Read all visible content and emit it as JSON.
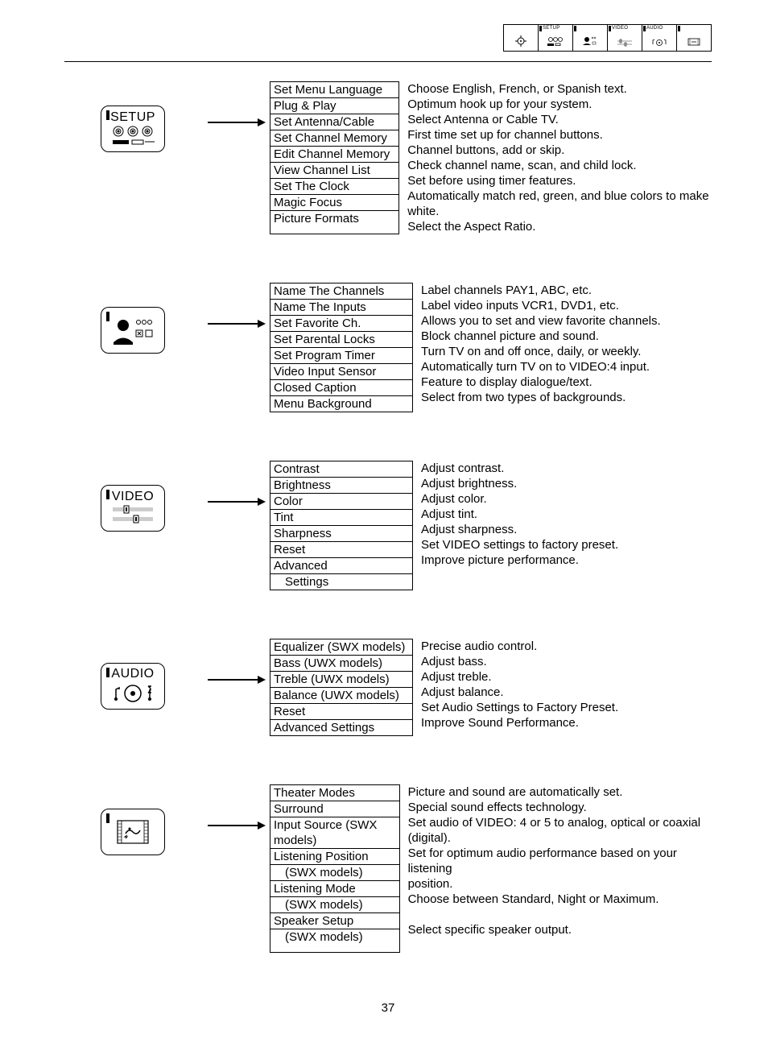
{
  "pageNumber": "37",
  "topStrip": {
    "labels": [
      "SETUP",
      "",
      "VIDEO",
      "AUDIO",
      ""
    ]
  },
  "sections": [
    {
      "iconLabel": "SETUP",
      "iconType": "setup",
      "menuWide": false,
      "items": [
        {
          "label": "Set Menu Language",
          "desc": "Choose English, French, or Spanish text."
        },
        {
          "label": "Plug & Play",
          "desc": "Optimum hook up for your system."
        },
        {
          "label": "Set Antenna/Cable",
          "desc": "Select Antenna or Cable TV."
        },
        {
          "label": "Set Channel Memory",
          "desc": "First time set up for channel buttons."
        },
        {
          "label": "Edit Channel Memory",
          "desc": "Channel buttons, add or skip."
        },
        {
          "label": "View Channel List",
          "desc": "Check channel name, scan, and child lock."
        },
        {
          "label": "Set The Clock",
          "desc": "Set before using timer features."
        },
        {
          "label": "Magic Focus",
          "desc": "Automatically match red, green, and blue colors to make white."
        },
        {
          "label": "Picture Formats",
          "desc": "Select  the Aspect Ratio."
        }
      ]
    },
    {
      "iconLabel": "",
      "iconType": "user",
      "menuWide": false,
      "items": [
        {
          "label": "Name The Channels",
          "desc": "Label channels PAY1, ABC, etc."
        },
        {
          "label": "Name The Inputs",
          "desc": "Label video inputs VCR1, DVD1, etc."
        },
        {
          "label": "Set Favorite Ch.",
          "desc": "Allows you to set and view favorite channels."
        },
        {
          "label": "Set Parental Locks",
          "desc": "Block channel picture and sound."
        },
        {
          "label": "Set Program Timer",
          "desc": "Turn TV on and off once, daily, or weekly."
        },
        {
          "label": "Video Input Sensor",
          "desc": "Automatically turn TV on to VIDEO:4 input."
        },
        {
          "label": "Closed Caption",
          "desc": "Feature to display dialogue/text."
        },
        {
          "label": "Menu Background",
          "desc": "Select from two types of backgrounds."
        }
      ]
    },
    {
      "iconLabel": "VIDEO",
      "iconType": "video",
      "menuWide": false,
      "items": [
        {
          "label": "Contrast",
          "desc": "Adjust contrast."
        },
        {
          "label": "Brightness",
          "desc": "Adjust brightness."
        },
        {
          "label": "Color",
          "desc": "Adjust color."
        },
        {
          "label": "Tint",
          "desc": "Adjust tint."
        },
        {
          "label": "Sharpness",
          "desc": "Adjust sharpness."
        },
        {
          "label": "Reset",
          "desc": "Set VIDEO settings to factory preset."
        },
        {
          "label": "Advanced",
          "desc": "Improve picture performance."
        },
        {
          "label": "   Settings",
          "sub": true,
          "desc": ""
        }
      ]
    },
    {
      "iconLabel": "AUDIO",
      "iconType": "audio",
      "menuWide": false,
      "items": [
        {
          "label": "Equalizer (SWX models)",
          "desc": "Precise audio control."
        },
        {
          "label": "Bass (UWX models)",
          "desc": "Adjust bass."
        },
        {
          "label": "Treble (UWX models)",
          "desc": "Adjust treble."
        },
        {
          "label": "Balance (UWX models)",
          "desc": "Adjust balance."
        },
        {
          "label": "Reset",
          "desc": "Set Audio Settings to Factory Preset."
        },
        {
          "label": "Advanced Settings",
          "desc": "Improve Sound Performance."
        }
      ]
    },
    {
      "iconLabel": "",
      "iconType": "film",
      "menuWide": true,
      "items": [
        {
          "label": "Theater Modes",
          "desc": "Picture and sound are automatically set."
        },
        {
          "label": "Surround",
          "desc": "Special sound effects technology."
        },
        {
          "label": "Input Source (SWX models)",
          "desc": "Set audio of VIDEO: 4 or 5 to analog, optical or coaxial (digital)."
        },
        {
          "label": "Listening Position",
          "desc": "Set for optimum audio performance based on your listening"
        },
        {
          "label": "   (SWX models)",
          "sub": true,
          "desc": "position."
        },
        {
          "label": "Listening Mode",
          "desc": "Choose between Standard, Night or Maximum."
        },
        {
          "label": "   (SWX models)",
          "sub": true,
          "desc": ""
        },
        {
          "label": "Speaker Setup",
          "desc": "Select specific speaker output."
        },
        {
          "label": "   (SWX models)",
          "sub": true,
          "desc": ""
        }
      ]
    }
  ]
}
